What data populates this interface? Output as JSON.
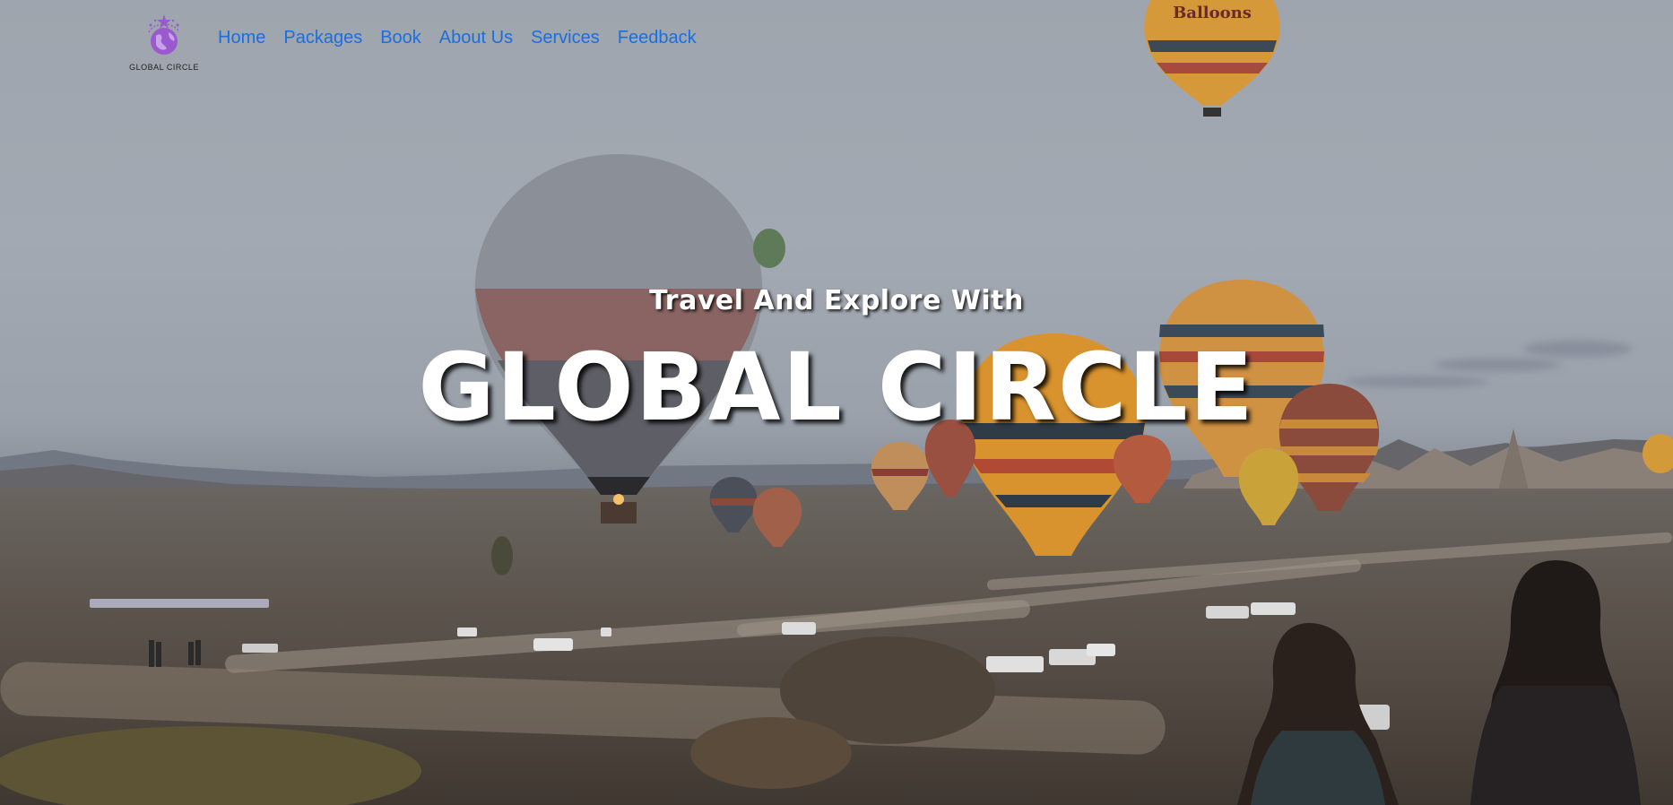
{
  "brand": {
    "logo_text": "GLOBAL CIRCLE",
    "logo_color": "#9b59d0"
  },
  "nav": {
    "items": [
      {
        "label": "Home"
      },
      {
        "label": "Packages"
      },
      {
        "label": "Book"
      },
      {
        "label": "About Us"
      },
      {
        "label": "Services"
      },
      {
        "label": "Feedback"
      }
    ],
    "link_color": "#1a6fe0"
  },
  "hero": {
    "subtitle": "Travel And Explore With",
    "title": "GLOBAL CIRCLE",
    "background_description_icon": "hot-air-balloons-photo"
  },
  "balloon_banner_text": "Balloons"
}
